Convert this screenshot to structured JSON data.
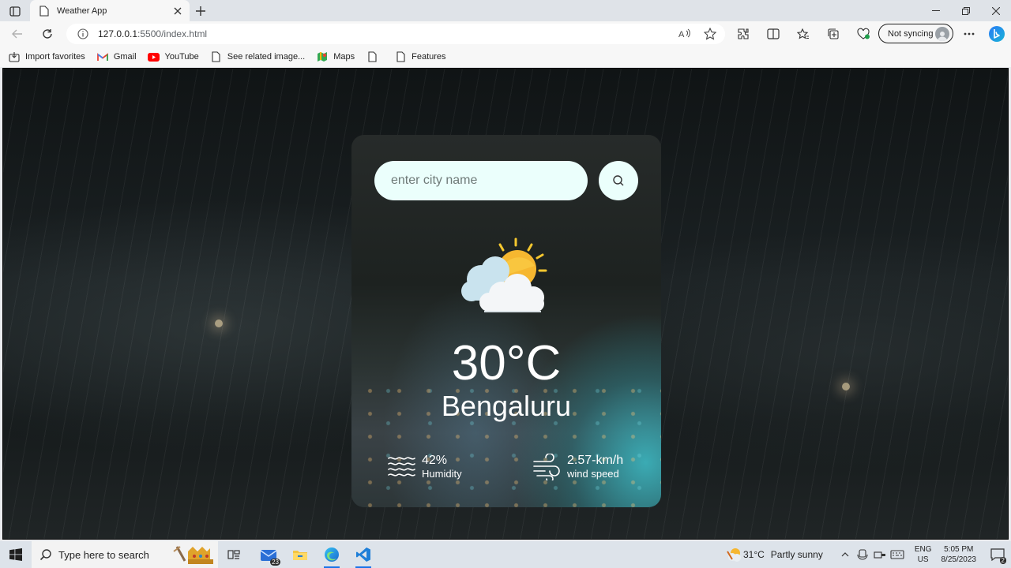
{
  "browser": {
    "tab_title": "Weather App",
    "url_host": "127.0.0.1",
    "url_path": ":5500/index.html",
    "sync_label": "Not syncing",
    "favorites": [
      {
        "label": "Import favorites",
        "icon": "import-icon"
      },
      {
        "label": "Gmail",
        "icon": "gmail-icon"
      },
      {
        "label": "YouTube",
        "icon": "youtube-icon"
      },
      {
        "label": "See related image...",
        "icon": "page-icon"
      },
      {
        "label": "Maps",
        "icon": "maps-icon"
      },
      {
        "label": "",
        "icon": "page-icon"
      },
      {
        "label": "Features",
        "icon": "page-icon"
      }
    ]
  },
  "app": {
    "search_placeholder": "enter city name",
    "temperature": "30°C",
    "city": "Bengaluru",
    "humidity_value": "42%",
    "humidity_label": "Humidity",
    "wind_value": "2.57-km/h",
    "wind_label": "wind speed",
    "weather_icon": "partly-cloudy-icon"
  },
  "taskbar": {
    "search_text": "Type here to search",
    "mail_badge": "23",
    "weather_temp": "31°C",
    "weather_desc": "Partly sunny",
    "lang_line1": "ENG",
    "lang_line2": "US",
    "time": "5:05 PM",
    "date": "8/25/2023",
    "notification_count": "2"
  },
  "colors": {
    "input_bg": "#ebfffc",
    "accent_blue": "#1a73e8",
    "sun": "#f5b731"
  }
}
